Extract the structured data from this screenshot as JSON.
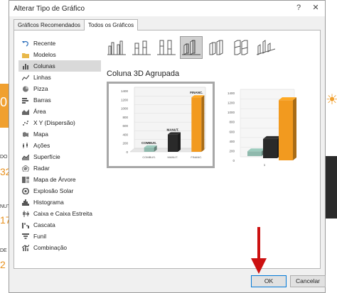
{
  "dialog": {
    "title": "Alterar Tipo de Gráfico",
    "help_icon": "?",
    "close_icon": "✕"
  },
  "tabs": [
    {
      "label": "Gráficos Recomendados"
    },
    {
      "label": "Todos os Gráficos"
    }
  ],
  "types": [
    {
      "label": "Recente",
      "icon": "undo-icon"
    },
    {
      "label": "Modelos",
      "icon": "folder-icon"
    },
    {
      "label": "Colunas",
      "icon": "column-chart-icon"
    },
    {
      "label": "Linhas",
      "icon": "line-chart-icon"
    },
    {
      "label": "Pizza",
      "icon": "pie-chart-icon"
    },
    {
      "label": "Barras",
      "icon": "bar-chart-icon"
    },
    {
      "label": "Área",
      "icon": "area-chart-icon"
    },
    {
      "label": "X Y (Dispersão)",
      "icon": "scatter-chart-icon"
    },
    {
      "label": "Mapa",
      "icon": "map-chart-icon"
    },
    {
      "label": "Ações",
      "icon": "stock-chart-icon"
    },
    {
      "label": "Superfície",
      "icon": "surface-chart-icon"
    },
    {
      "label": "Radar",
      "icon": "radar-chart-icon"
    },
    {
      "label": "Mapa de Árvore",
      "icon": "treemap-icon"
    },
    {
      "label": "Explosão Solar",
      "icon": "sunburst-icon"
    },
    {
      "label": "Histograma",
      "icon": "histogram-icon"
    },
    {
      "label": "Caixa e Caixa Estreita",
      "icon": "boxwhisker-icon"
    },
    {
      "label": "Cascata",
      "icon": "waterfall-icon"
    },
    {
      "label": "Funil",
      "icon": "funnel-icon"
    },
    {
      "label": "Combinação",
      "icon": "combo-chart-icon"
    }
  ],
  "selected_type": "Colunas",
  "subtype_title": "Coluna 3D Agrupada",
  "preview": {
    "yticks": [
      "1400",
      "1200",
      "1000",
      "800",
      "600",
      "400",
      "200",
      "0"
    ],
    "labels": [
      "COMBUS.",
      "MANUT.",
      "FINANC."
    ],
    "values": [
      100,
      400,
      1250
    ],
    "colors": [
      "#8fb9ad",
      "#2a2a2a",
      "#f29a1f"
    ]
  },
  "preview2": {
    "yticks": [
      "1400",
      "1200",
      "1000",
      "800",
      "600",
      "400",
      "200",
      "0"
    ],
    "xlabel": "1"
  },
  "buttons": {
    "ok": "OK",
    "cancel": "Cancelar"
  },
  "background": {
    "left_digits": [
      "0",
      "32",
      "17",
      "2"
    ],
    "left_tags": [
      "DO",
      "NUT",
      "DE"
    ]
  }
}
